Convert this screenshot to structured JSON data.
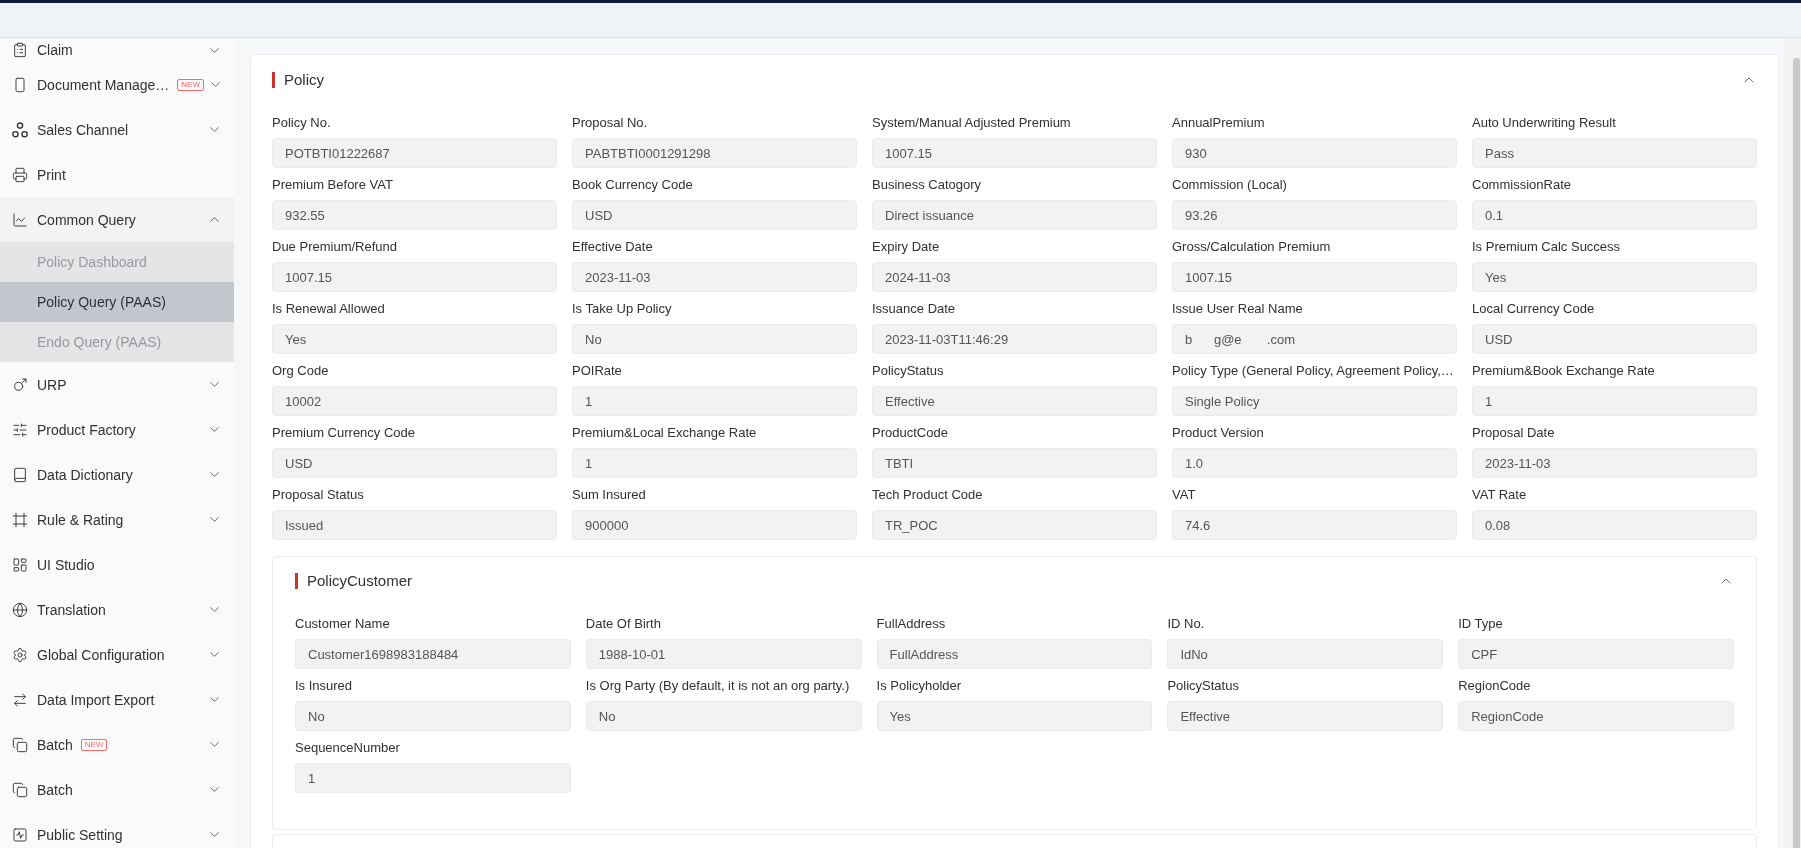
{
  "sidebar": {
    "items": [
      {
        "label": "Claim",
        "expanded": false
      },
      {
        "label": "Document Manage…",
        "badge": "NEW",
        "expanded": false
      },
      {
        "label": "Sales Channel",
        "expanded": false
      },
      {
        "label": "Print"
      },
      {
        "label": "Common Query",
        "expanded": true,
        "children": [
          {
            "label": "Policy Dashboard",
            "selected": false
          },
          {
            "label": "Policy Query (PAAS)",
            "selected": true
          },
          {
            "label": "Endo Query (PAAS)",
            "selected": false
          }
        ]
      },
      {
        "label": "URP",
        "expanded": false
      },
      {
        "label": "Product Factory",
        "expanded": false
      },
      {
        "label": "Data Dictionary",
        "expanded": false
      },
      {
        "label": "Rule & Rating",
        "expanded": false
      },
      {
        "label": "UI Studio"
      },
      {
        "label": "Translation",
        "expanded": false
      },
      {
        "label": "Global Configuration",
        "expanded": false
      },
      {
        "label": "Data Import Export",
        "expanded": false
      },
      {
        "label": "Batch",
        "badge": "NEW",
        "expanded": false
      },
      {
        "label": "Batch",
        "expanded": false
      },
      {
        "label": "Public Setting",
        "expanded": false
      }
    ]
  },
  "sections": [
    {
      "title": "Policy",
      "expanded": true,
      "fields": [
        {
          "label": "Policy No.",
          "value": "POTBTI01222687"
        },
        {
          "label": "Proposal No.",
          "value": "PABTBTI0001291298"
        },
        {
          "label": "System/Manual Adjusted Premium",
          "value": "1007.15"
        },
        {
          "label": "AnnualPremium",
          "value": "930"
        },
        {
          "label": "Auto Underwriting Result",
          "value": "Pass"
        },
        {
          "label": "Premium Before VAT",
          "value": "932.55"
        },
        {
          "label": "Book Currency Code",
          "value": "USD"
        },
        {
          "label": "Business Catogory",
          "value": "Direct issuance"
        },
        {
          "label": "Commission (Local)",
          "value": "93.26"
        },
        {
          "label": "CommissionRate",
          "value": "0.1"
        },
        {
          "label": "Due Premium/Refund",
          "value": "1007.15"
        },
        {
          "label": "Effective Date",
          "value": "2023-11-03"
        },
        {
          "label": "Expiry Date",
          "value": "2024-11-03"
        },
        {
          "label": "Gross/Calculation Premium",
          "value": "1007.15"
        },
        {
          "label": "Is Premium Calc Success",
          "value": "Yes"
        },
        {
          "label": "Is Renewal Allowed",
          "value": "Yes"
        },
        {
          "label": "Is Take Up Policy",
          "value": "No"
        },
        {
          "label": "Issuance Date",
          "value": "2023-11-03T11:46:29"
        },
        {
          "label": "Issue User Real Name",
          "value": "b      g@e       .com"
        },
        {
          "label": "Local Currency Code",
          "value": "USD"
        },
        {
          "label": "Org Code",
          "value": "10002"
        },
        {
          "label": "POIRate",
          "value": "1"
        },
        {
          "label": "PolicyStatus",
          "value": "Effective"
        },
        {
          "label": "Policy Type (General Policy, Agreement Policy,…",
          "value": "Single Policy"
        },
        {
          "label": "Premium&Book Exchange Rate",
          "value": "1"
        },
        {
          "label": "Premium Currency Code",
          "value": "USD"
        },
        {
          "label": "Premium&Local Exchange Rate",
          "value": "1"
        },
        {
          "label": "ProductCode",
          "value": "TBTI"
        },
        {
          "label": "Product Version",
          "value": "1.0"
        },
        {
          "label": "Proposal Date",
          "value": "2023-11-03"
        },
        {
          "label": "Proposal Status",
          "value": "Issued"
        },
        {
          "label": "Sum Insured",
          "value": "900000"
        },
        {
          "label": "Tech Product Code",
          "value": "TR_POC"
        },
        {
          "label": "VAT",
          "value": "74.6"
        },
        {
          "label": "VAT Rate",
          "value": "0.08"
        }
      ],
      "subsections": [
        {
          "title": "PolicyCustomer",
          "expanded": true,
          "fields": [
            {
              "label": "Customer Name",
              "value": "Customer1698983188484"
            },
            {
              "label": "Date Of Birth",
              "value": "1988-10-01"
            },
            {
              "label": "FullAddress",
              "value": "FullAddress"
            },
            {
              "label": "ID No.",
              "value": "IdNo"
            },
            {
              "label": "ID Type",
              "value": "CPF"
            },
            {
              "label": "Is Insured",
              "value": "No"
            },
            {
              "label": "Is Org Party (By default, it is not an org party.)",
              "value": "No"
            },
            {
              "label": "Is Policyholder",
              "value": "Yes"
            },
            {
              "label": "PolicyStatus",
              "value": "Effective"
            },
            {
              "label": "RegionCode",
              "value": "RegionCode"
            },
            {
              "label": "SequenceNumber",
              "value": "1"
            }
          ]
        }
      ]
    }
  ]
}
